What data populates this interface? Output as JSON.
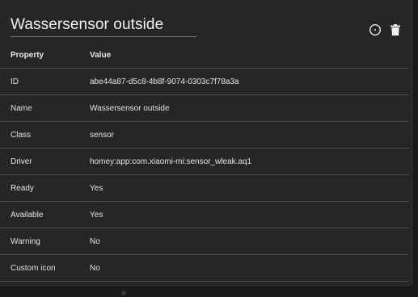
{
  "device": {
    "title": "Wassersensor outside"
  },
  "icons": {
    "circle": "circle-outline-icon",
    "delete": "trash-icon"
  },
  "table": {
    "headers": {
      "property": "Property",
      "value": "Value"
    },
    "rows": [
      {
        "property": "ID",
        "value": "abe44a87-d5c8-4b8f-9074-0303c7f78a3a"
      },
      {
        "property": "Name",
        "value": "Wassersensor outside"
      },
      {
        "property": "Class",
        "value": "sensor"
      },
      {
        "property": "Driver",
        "value": "homey:app:com.xiaomi-mi:sensor_wleak.aq1"
      },
      {
        "property": "Ready",
        "value": "Yes"
      },
      {
        "property": "Available",
        "value": "Yes"
      },
      {
        "property": "Warning",
        "value": "No"
      },
      {
        "property": "Custom icon",
        "value": "No"
      }
    ]
  },
  "colors": {
    "background": "#1b1b1d",
    "card": "#262628",
    "divider": "#48484a"
  }
}
